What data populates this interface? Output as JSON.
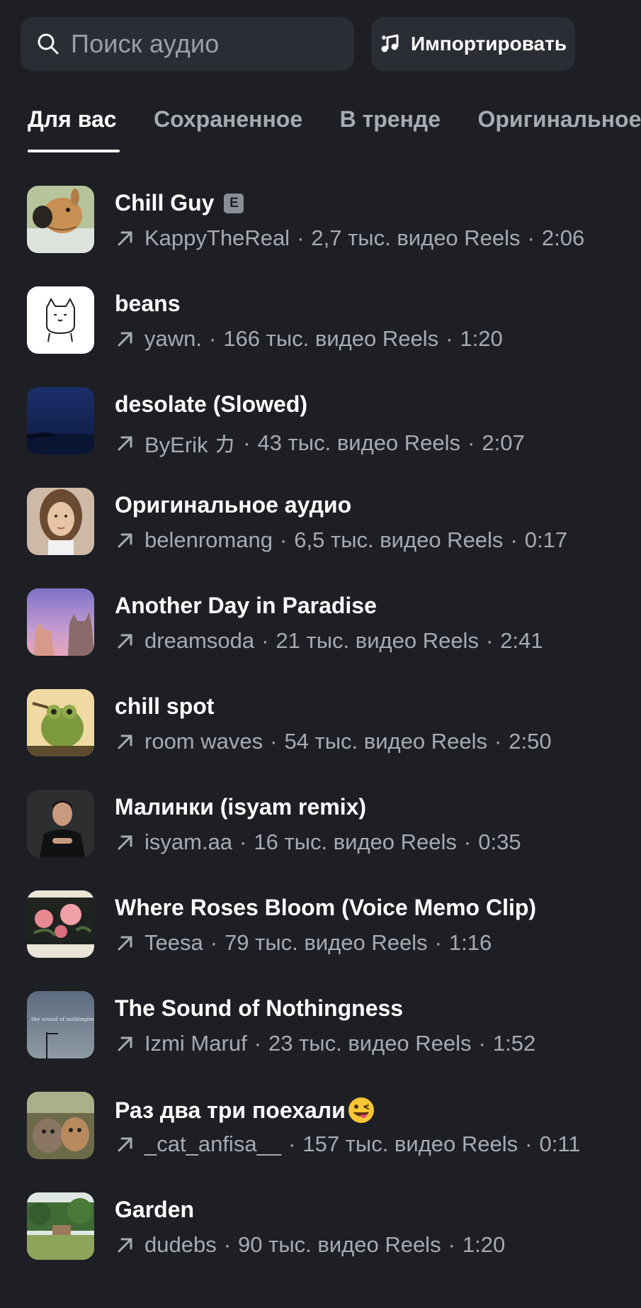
{
  "search": {
    "placeholder": "Поиск аудио",
    "icon": "search-icon"
  },
  "import_button": {
    "label": "Импортировать",
    "icon": "music-note-plus-icon"
  },
  "tabs": [
    {
      "label": "Для вас",
      "active": true
    },
    {
      "label": "Сохраненное",
      "active": false
    },
    {
      "label": "В тренде",
      "active": false
    },
    {
      "label": "Оригинальное",
      "active": false
    }
  ],
  "separator": "·",
  "tracks": [
    {
      "title": "Chill Guy",
      "explicit": "E",
      "artist": "KappyTheReal",
      "reels": "2,7 тыс. видео Reels",
      "duration": "2:06",
      "thumb": "cartoon-dog"
    },
    {
      "title": "beans",
      "artist": "yawn.",
      "reels": "166 тыс. видео Reels",
      "duration": "1:20",
      "thumb": "cat-drawing"
    },
    {
      "title": "desolate (Slowed)",
      "artist": "ByErik カ",
      "reels": "43 тыс. видео Reels",
      "duration": "2:07",
      "thumb": "night-sea"
    },
    {
      "title": "Оригинальное аудио",
      "artist": "belenromang",
      "reels": "6,5 тыс. видео Reels",
      "duration": "0:17",
      "thumb": "portrait-woman"
    },
    {
      "title": "Another Day in Paradise",
      "artist": "dreamsoda",
      "reels": "21 тыс. видео Reels",
      "duration": "2:41",
      "thumb": "cats-sunset"
    },
    {
      "title": "chill spot",
      "artist": "room waves",
      "reels": "54 тыс. видео Reels",
      "duration": "2:50",
      "thumb": "frog"
    },
    {
      "title": "Малинки (isyam remix)",
      "artist": "isyam.aa",
      "reels": "16 тыс. видео Reels",
      "duration": "0:35",
      "thumb": "portrait-man"
    },
    {
      "title": "Where Roses Bloom (Voice Memo Clip)",
      "artist": "Teesa",
      "reels": "79 тыс. видео Reels",
      "duration": "1:16",
      "thumb": "roses"
    },
    {
      "title": "The Sound of Nothingness",
      "artist": "Izmi Maruf",
      "reels": "23 тыс. видео Reels",
      "duration": "1:52",
      "thumb": "sound-of-nothingness",
      "thumb_text": "the sound of nothingness"
    },
    {
      "title": "Раз два три поехали",
      "emoji": "winking-tongue-emoji",
      "artist": "_cat_anfisa__",
      "reels": "157 тыс. видео Reels",
      "duration": "0:11",
      "thumb": "cats-photo"
    },
    {
      "title": "Garden",
      "artist": "dudebs",
      "reels": "90 тыс. видео Reels",
      "duration": "1:20",
      "thumb": "garden"
    }
  ],
  "colors": {
    "background": "#1d1f24",
    "surface": "#2a2d33",
    "text_primary": "#ffffff",
    "text_secondary": "#a6abb3"
  }
}
